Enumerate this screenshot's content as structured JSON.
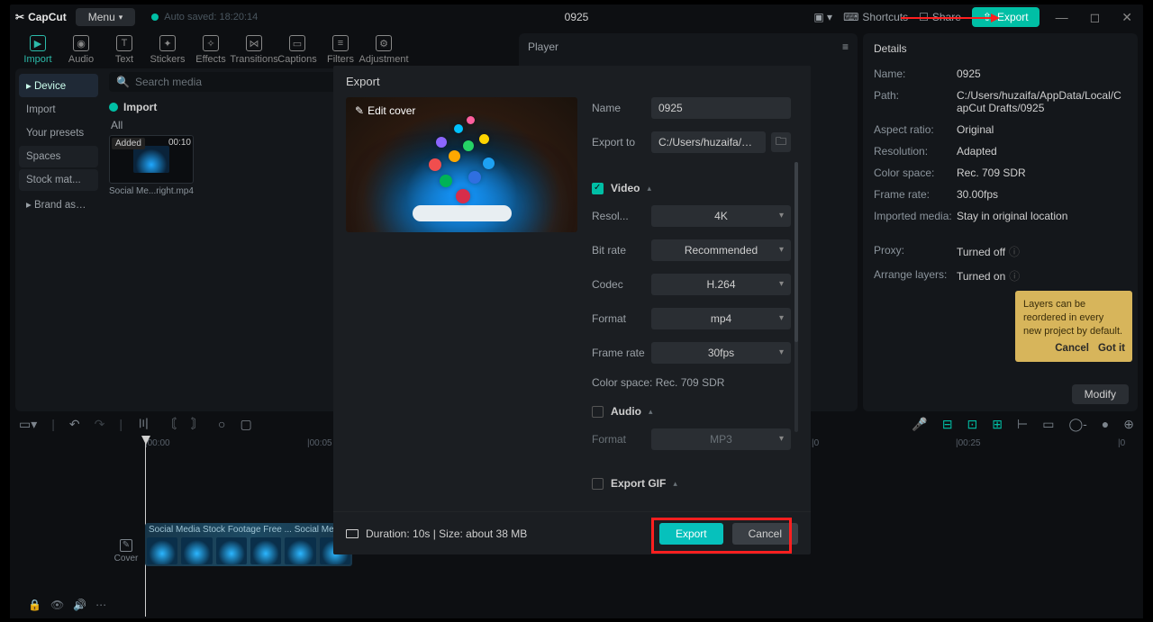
{
  "titlebar": {
    "logo": "CapCut",
    "menu": "Menu",
    "autosave": "Auto saved: 18:20:14",
    "project": "0925",
    "shortcuts": "Shortcuts",
    "share": "Share",
    "export": "Export"
  },
  "tabs": {
    "import": "Import",
    "audio": "Audio",
    "text": "Text",
    "stickers": "Stickers",
    "effects": "Effects",
    "transitions": "Transitions",
    "captions": "Captions",
    "filters": "Filters",
    "adjustment": "Adjustment"
  },
  "sidebar": {
    "device": "Device",
    "import": "Import",
    "presets": "Your presets",
    "spaces": "Spaces",
    "stock": "Stock mat...",
    "brand": "Brand assets"
  },
  "media": {
    "search_placeholder": "Search media",
    "import_label": "Import",
    "all_label": "All",
    "thumb_badge": "Added",
    "thumb_dur": "00:10",
    "thumb_caption": "Social Me...right.mp4"
  },
  "player_label": "Player",
  "details": {
    "title": "Details",
    "name_k": "Name:",
    "name_v": "0925",
    "path_k": "Path:",
    "path_v": "C:/Users/huzaifa/AppData/Local/CapCut Drafts/0925",
    "ar_k": "Aspect ratio:",
    "ar_v": "Original",
    "res_k": "Resolution:",
    "res_v": "Adapted",
    "cs_k": "Color space:",
    "cs_v": "Rec. 709 SDR",
    "fr_k": "Frame rate:",
    "fr_v": "30.00fps",
    "im_k": "Imported media:",
    "im_v": "Stay in original location",
    "proxy_k": "Proxy:",
    "proxy_v": "Turned off",
    "layers_k": "Arrange layers:",
    "layers_v": "Turned on",
    "modify": "Modify"
  },
  "hint": {
    "text": "Layers can be reordered in every new project by default.",
    "cancel": "Cancel",
    "gotit": "Got it"
  },
  "ruler": {
    "t0": "|00:00",
    "t1": "|00:05",
    "t2": "|0",
    "t3": "|00:25",
    "t4": "|0"
  },
  "clip_label": "Social Media Stock Footage Free ... Social Media A",
  "cover": "Cover",
  "dialog": {
    "title": "Export",
    "edit_cover": "Edit cover",
    "name_k": "Name",
    "name_v": "0925",
    "exportto_k": "Export to",
    "exportto_v": "C:/Users/huzaifa/App...",
    "video": "Video",
    "resol_k": "Resol...",
    "resol_v": "4K",
    "bitrate_k": "Bit rate",
    "bitrate_v": "Recommended",
    "codec_k": "Codec",
    "codec_v": "H.264",
    "format_k": "Format",
    "format_v": "mp4",
    "framerate_k": "Frame rate",
    "framerate_v": "30fps",
    "colorspace": "Color space: Rec. 709 SDR",
    "audio": "Audio",
    "aformat_k": "Format",
    "aformat_v": "MP3",
    "gif": "Export GIF",
    "duration": "Duration: 10s | Size: about 38 MB",
    "export_btn": "Export",
    "cancel_btn": "Cancel"
  }
}
